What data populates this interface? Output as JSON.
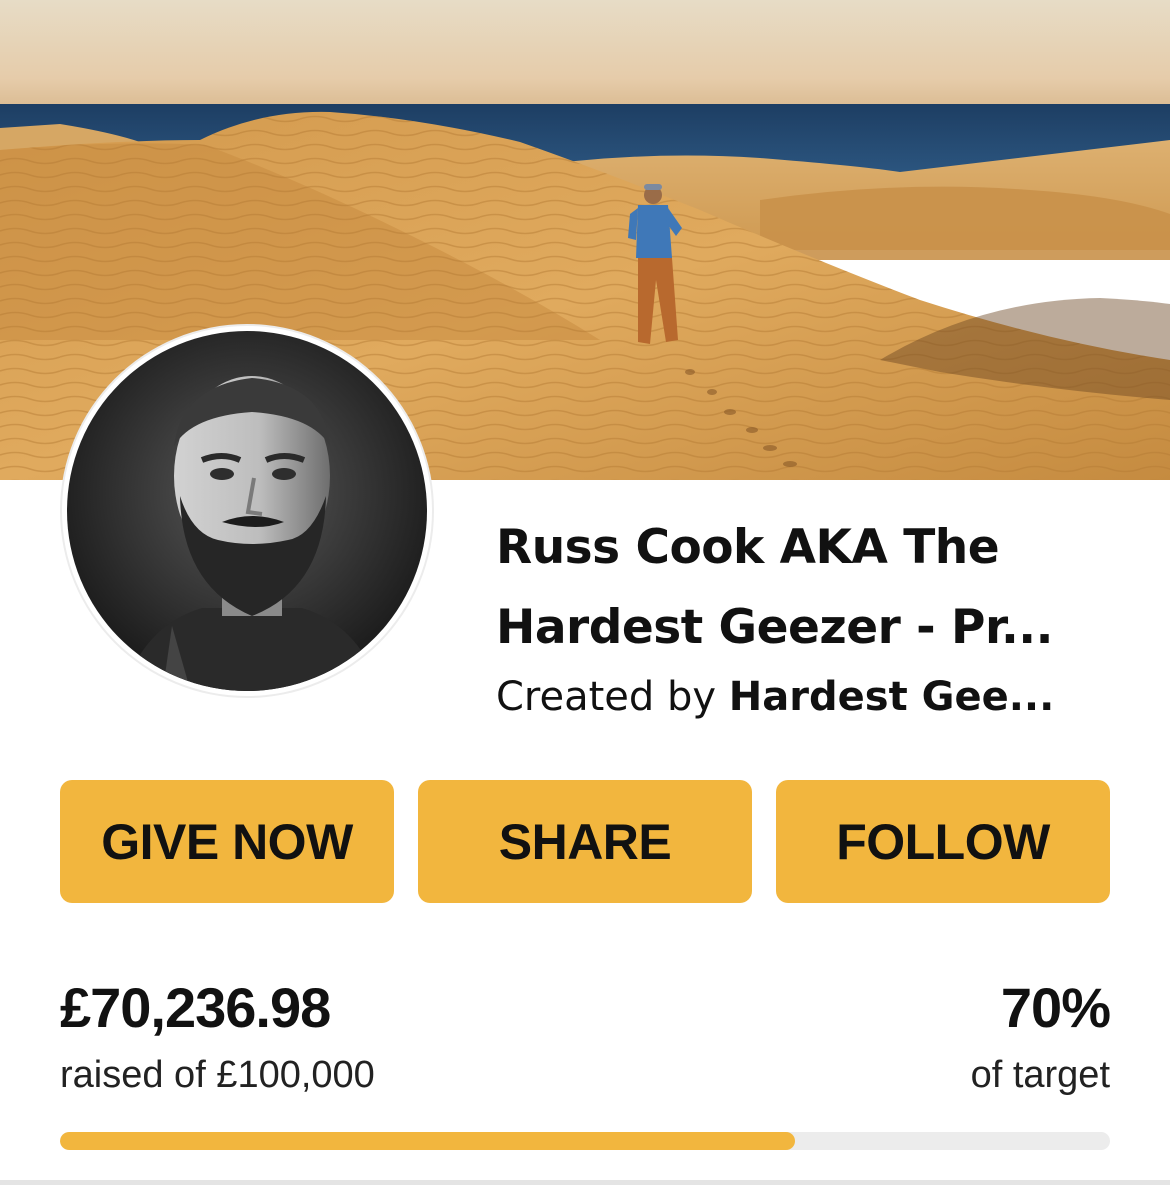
{
  "banner": {
    "image": "desert-dunes-runner-photo"
  },
  "avatar": {
    "image": "bearded-man-portrait-photo"
  },
  "campaign": {
    "title": "Russ Cook AKA The Hardest Geezer - Pr...",
    "created_by_prefix": "Created by ",
    "creator_name": "Hardest Gee..."
  },
  "actions": {
    "give_now": "GIVE NOW",
    "share": "SHARE",
    "follow": "FOLLOW"
  },
  "stats": {
    "amount_raised": "£70,236.98",
    "raised_of_label": "raised of £100,000",
    "percent": "70%",
    "percent_label": "of target",
    "progress_fraction": 0.7
  },
  "colors": {
    "accent": "#f2b63e",
    "track": "#ececec",
    "text": "#111111"
  }
}
